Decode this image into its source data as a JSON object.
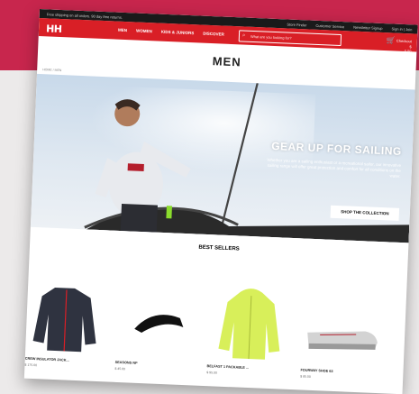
{
  "utility": {
    "promo": "Free shipping on all orders. 90 day free returns.",
    "links": [
      "Store Finder",
      "Customer Service",
      "Newsletter Signup",
      "Sign in | Join"
    ]
  },
  "brand": {
    "logo": "HH",
    "accent": "#d91f26",
    "background_band": "#c8264d"
  },
  "nav": {
    "items": [
      "MEN",
      "WOMEN",
      "KIDS & JUNIORS",
      "DISCOVER"
    ]
  },
  "search": {
    "placeholder": "What are you looking for?"
  },
  "cart": {
    "count": "0",
    "label": "Checkout",
    "total": "$ 0.00"
  },
  "page": {
    "title": "MEN",
    "breadcrumb": "HOME / MEN"
  },
  "hero": {
    "heading": "GEAR UP FOR SAILING",
    "body": "Whether you are a sailing enthusiast or a recreational sailor, our innovative sailing range will offer great protection and comfort for all conditions on the water.",
    "cta": "SHOP THE COLLECTION"
  },
  "best_sellers": {
    "title": "BEST SELLERS",
    "products": [
      {
        "name": "CREW INSULATOR JACK...",
        "price": "$ 175.00"
      },
      {
        "name": "SEASONS NP",
        "price": "$ 45.00"
      },
      {
        "name": "BELFAST 1 PACKABLE ...",
        "price": "$ 95.00"
      },
      {
        "name": "FOURWAY SHOE 63",
        "price": "$ 85.00"
      }
    ]
  }
}
